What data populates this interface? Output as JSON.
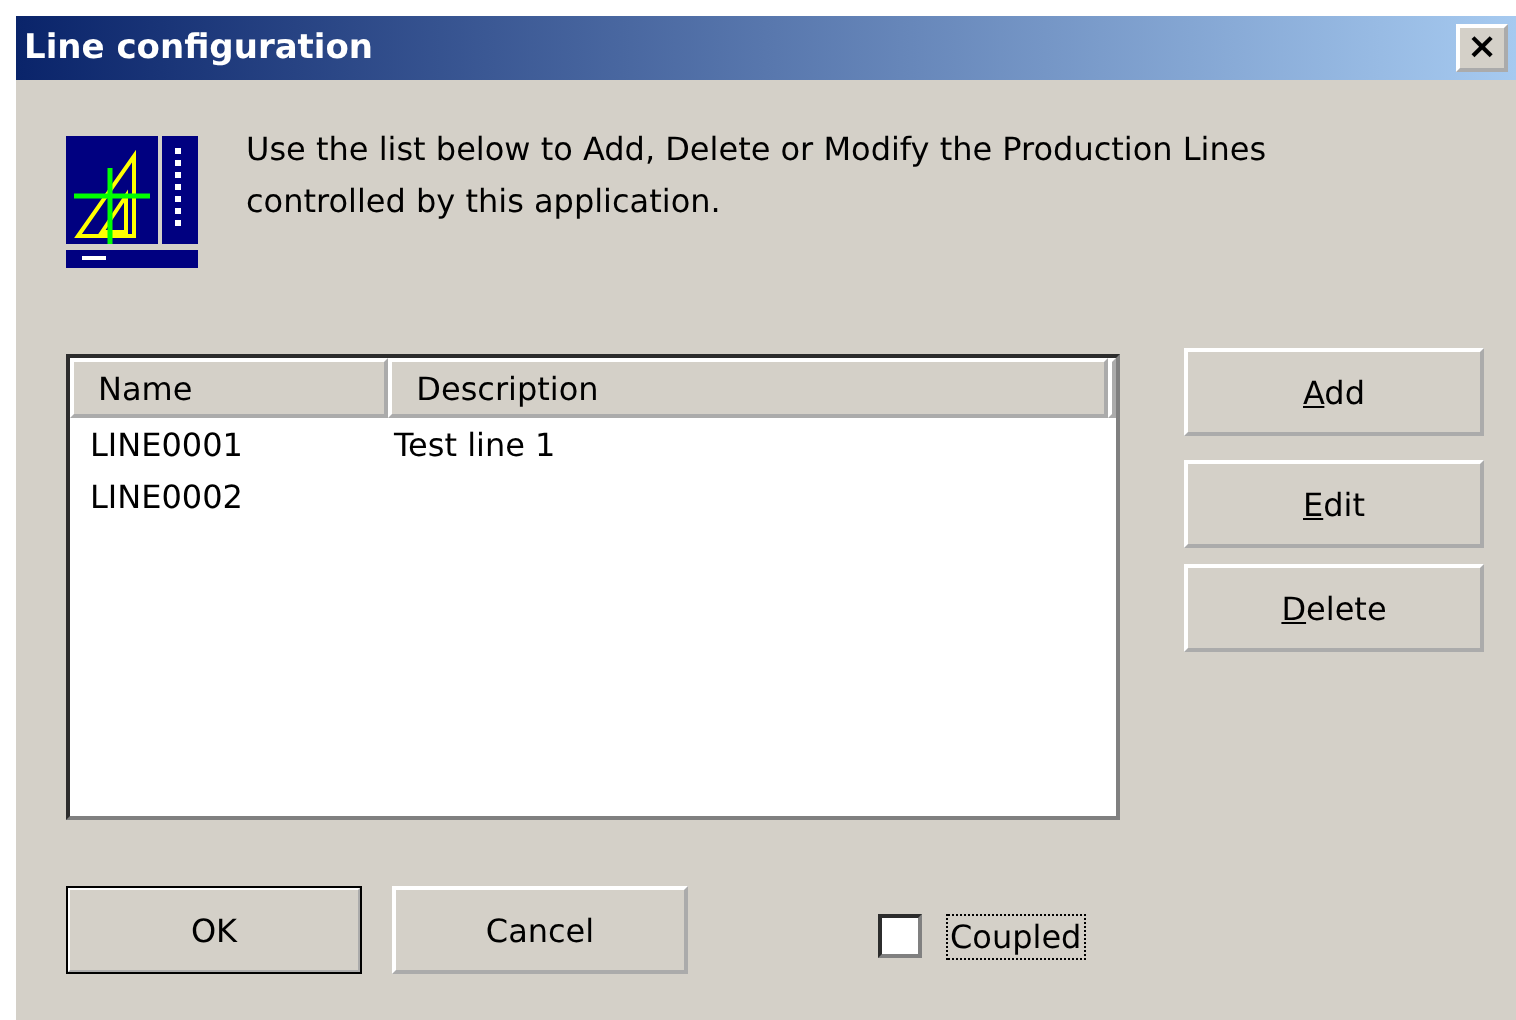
{
  "window": {
    "title": "Line configuration",
    "close": "×"
  },
  "message": "Use the list below to Add, Delete or Modify the Production Lines controlled by this application.",
  "list": {
    "columns": [
      "Name",
      "Description"
    ],
    "rows": [
      {
        "cells": [
          "LINE0001",
          "Test line 1"
        ]
      },
      {
        "cells": [
          "LINE0002",
          ""
        ]
      }
    ]
  },
  "side_buttons": [
    "Add",
    "Edit",
    "Delete"
  ],
  "buttons": [
    {
      "label": "OK",
      "default": true
    },
    {
      "label": "Cancel",
      "default": false
    }
  ],
  "coupled": {
    "label": "Coupled",
    "checked": false,
    "focused": true
  }
}
